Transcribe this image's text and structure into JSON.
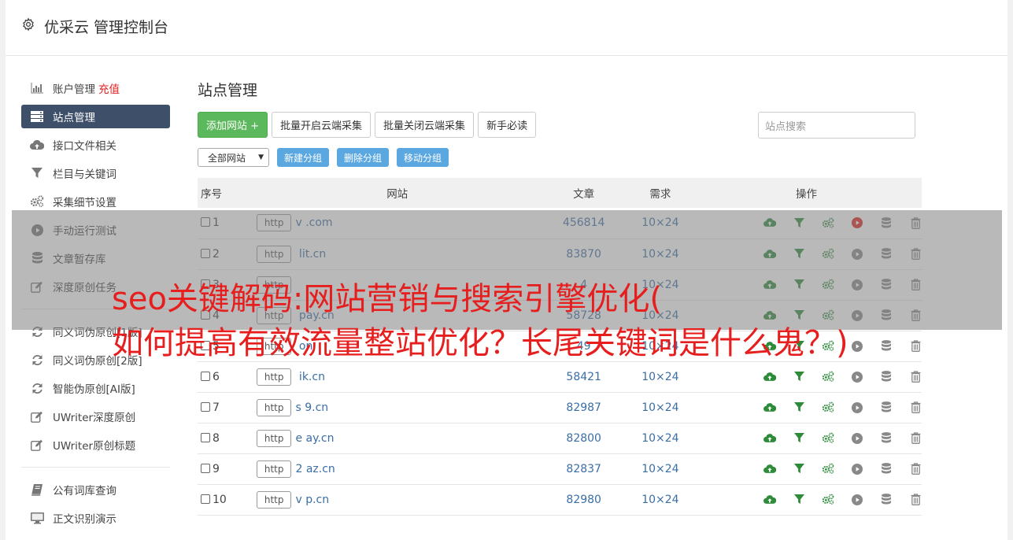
{
  "app": {
    "title": "优采云 管理控制台"
  },
  "sidebar": {
    "group1": [
      {
        "label": "账户管理",
        "extra": "充值",
        "icon": "bar-chart-icon"
      },
      {
        "label": "站点管理",
        "icon": "server-list-icon",
        "active": true
      },
      {
        "label": "接口文件相关",
        "icon": "cloud-upload-icon"
      },
      {
        "label": "栏目与关键词",
        "icon": "filter-icon"
      },
      {
        "label": "采集细节设置",
        "icon": "gears-icon"
      },
      {
        "label": "手动运行测试",
        "icon": "play-circle-icon"
      },
      {
        "label": "文章暂存库",
        "icon": "database-icon"
      },
      {
        "label": "深度原创任务",
        "icon": "edit-icon"
      }
    ],
    "group2": [
      {
        "label": "同义词伪原创[1版]",
        "icon": "refresh-icon"
      },
      {
        "label": "同义词伪原创[2版]",
        "icon": "refresh-icon"
      },
      {
        "label": "智能伪原创[AI版]",
        "icon": "refresh-icon"
      },
      {
        "label": "UWriter深度原创",
        "icon": "edit-icon"
      },
      {
        "label": "UWriter原创标题",
        "icon": "edit-icon"
      }
    ],
    "group3": [
      {
        "label": "公有词库查询",
        "icon": "book-icon"
      },
      {
        "label": "正文识别演示",
        "icon": "monitor-icon"
      }
    ]
  },
  "main": {
    "title": "站点管理",
    "buttons": {
      "add": "添加网站 +",
      "batch_open": "批量开启云端采集",
      "batch_close": "批量关闭云端采集",
      "guide": "新手必读"
    },
    "search_placeholder": "站点搜索",
    "group_select": "全部网站",
    "group_buttons": {
      "new": "新建分组",
      "delete": "删除分组",
      "move": "移动分组"
    },
    "table": {
      "headers": {
        "no": "序号",
        "site": "网站",
        "articles": "文章",
        "demand": "需求",
        "ops": "操作"
      },
      "rows": [
        {
          "no": "1",
          "proto": "http",
          "domain": "v          .com",
          "articles": "456814",
          "demand": "10×24",
          "running": true
        },
        {
          "no": "2",
          "proto": "http",
          "domain": "       lit.cn",
          "articles": "83870",
          "demand": "10×24"
        },
        {
          "no": "3",
          "proto": "http",
          "domain": "",
          "articles": "4",
          "demand": "10×24"
        },
        {
          "no": "4",
          "proto": "http",
          "domain": "       pay.cn",
          "articles": "58728",
          "demand": "10×24"
        },
        {
          "no": "5",
          "proto": "http",
          "domain": "        on",
          "articles": "49",
          "demand": "10×24"
        },
        {
          "no": "6",
          "proto": "http",
          "domain": "       ik.cn",
          "articles": "58421",
          "demand": "10×24"
        },
        {
          "no": "7",
          "proto": "http",
          "domain": "s     9.cn",
          "articles": "82987",
          "demand": "10×24"
        },
        {
          "no": "8",
          "proto": "http",
          "domain": "e     ay.cn",
          "articles": "82800",
          "demand": "10×24"
        },
        {
          "no": "9",
          "proto": "http",
          "domain": "2     az.cn",
          "articles": "82837",
          "demand": "10×24"
        },
        {
          "no": "10",
          "proto": "http",
          "domain": "v     p.cn",
          "articles": "82980",
          "demand": "10×24"
        }
      ]
    }
  },
  "overlay": {
    "line1": "seo关键解码:网站营销与搜索引擎优化(",
    "line2": "如何提高有效流量整站优化？长尾关键词是什么鬼？)"
  },
  "colors": {
    "accent": "#3e4f6a",
    "green": "#5cb85c",
    "blue_button": "#5ba8e0",
    "link": "#3a6ea5",
    "overlay_text": "#e61e1e"
  }
}
